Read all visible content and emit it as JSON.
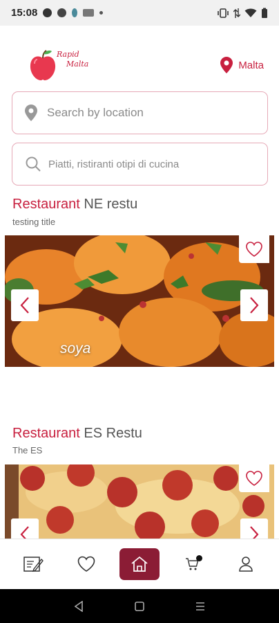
{
  "status_bar": {
    "time": "15:08"
  },
  "header": {
    "logo_line1": "Rapid",
    "logo_line2": "Malta",
    "location_label": "Malta"
  },
  "search": {
    "location_placeholder": "Search by location",
    "dish_placeholder": "Piatti, ristiranti otipi di cucina"
  },
  "restaurants": [
    {
      "prefix": "Restaurant",
      "name": "NE restu",
      "subtitle": "testing title",
      "image_caption": "soya"
    },
    {
      "prefix": "Restaurant",
      "name": "ES Restu",
      "subtitle": "The ES",
      "image_caption": ""
    }
  ],
  "bottom_nav": {
    "items": [
      {
        "icon": "edit-menu-icon"
      },
      {
        "icon": "heart-icon"
      },
      {
        "icon": "home-icon",
        "active": true
      },
      {
        "icon": "cart-icon",
        "badge": true
      },
      {
        "icon": "user-icon"
      }
    ]
  },
  "colors": {
    "accent": "#c8203f",
    "home_active_bg": "#8b1c35",
    "search_border": "#e6a8b6"
  }
}
